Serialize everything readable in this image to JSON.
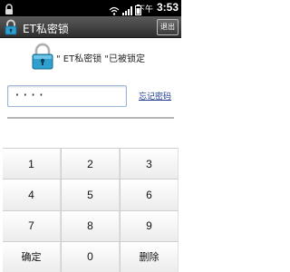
{
  "status_bar": {
    "carrier_text": "下午",
    "time": "3:53",
    "icons": [
      "lock-icon",
      "wifi-icon",
      "signal-icon",
      "battery-icon"
    ]
  },
  "title_bar": {
    "title": "ET私密锁",
    "exit_label": "退出"
  },
  "lock_message": "\" ET私密锁 \"已被锁定",
  "password_field": {
    "value": "····"
  },
  "forgot_link": "忘记密码",
  "keypad": {
    "keys": [
      "1",
      "2",
      "3",
      "4",
      "5",
      "6",
      "7",
      "8",
      "9",
      "确定",
      "0",
      "删除"
    ]
  },
  "colors": {
    "title_bar": "#3c3c3c",
    "link": "#1f3a8f",
    "lock_body": "#2f9fcf"
  }
}
